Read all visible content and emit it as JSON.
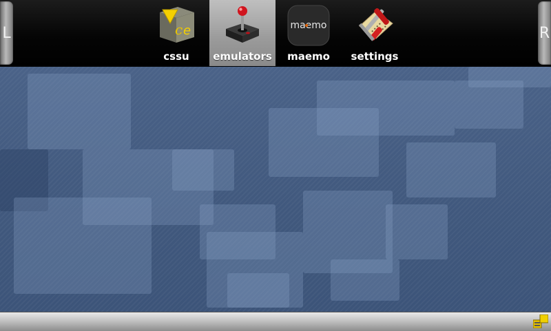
{
  "topbar": {
    "left_label": "L",
    "right_label": "R",
    "tabs": [
      {
        "label": "cssu",
        "icon": "cssu-cube-icon",
        "active": false
      },
      {
        "label": "emulators",
        "icon": "joystick-icon",
        "active": true
      },
      {
        "label": "maemo",
        "icon": "maemo-logo-icon",
        "logo_text": "maemo",
        "active": false
      },
      {
        "label": "settings",
        "icon": "tools-icon",
        "active": false
      }
    ]
  },
  "bottombar": {
    "task_icon": "task-switcher-icon"
  },
  "colors": {
    "accent_active_tab": "#a8a8a8",
    "wallpaper": "#425c82"
  }
}
